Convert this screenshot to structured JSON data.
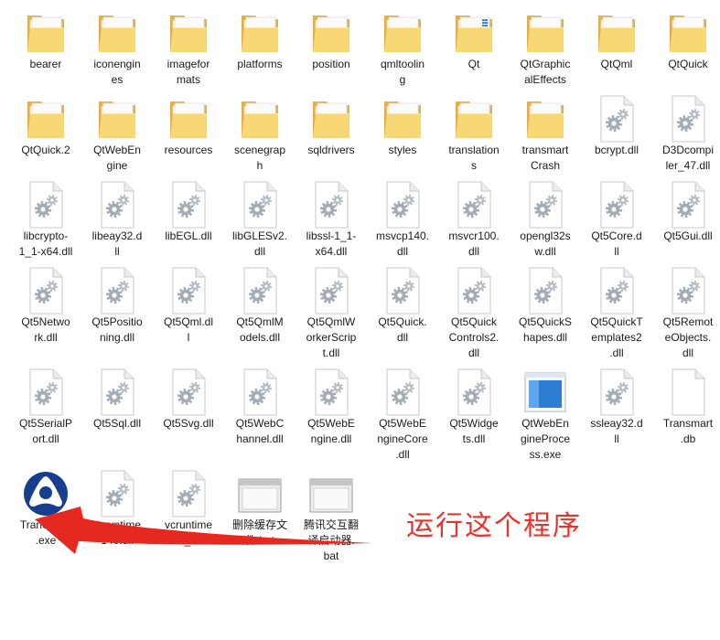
{
  "items": [
    {
      "icon": "folder",
      "lines": [
        "bearer"
      ]
    },
    {
      "icon": "folder",
      "lines": [
        "iconengin",
        "es"
      ]
    },
    {
      "icon": "folder",
      "lines": [
        "imagefor",
        "mats"
      ]
    },
    {
      "icon": "folder",
      "lines": [
        "platforms"
      ]
    },
    {
      "icon": "folder",
      "lines": [
        "position"
      ]
    },
    {
      "icon": "folder",
      "lines": [
        "qmltoolin",
        "g"
      ]
    },
    {
      "icon": "folder-doc",
      "lines": [
        "Qt"
      ]
    },
    {
      "icon": "folder",
      "lines": [
        "QtGraphic",
        "alEffects"
      ]
    },
    {
      "icon": "folder",
      "lines": [
        "QtQml"
      ]
    },
    {
      "icon": "folder",
      "lines": [
        "QtQuick"
      ]
    },
    {
      "icon": "folder",
      "lines": [
        "QtQuick.2"
      ]
    },
    {
      "icon": "folder",
      "lines": [
        "QtWebEn",
        "gine"
      ]
    },
    {
      "icon": "folder",
      "lines": [
        "resources"
      ]
    },
    {
      "icon": "folder",
      "lines": [
        "scenegrap",
        "h"
      ]
    },
    {
      "icon": "folder",
      "lines": [
        "sqldrivers"
      ]
    },
    {
      "icon": "folder",
      "lines": [
        "styles"
      ]
    },
    {
      "icon": "folder",
      "lines": [
        "translation",
        "s"
      ]
    },
    {
      "icon": "folder",
      "lines": [
        "transmart",
        "Crash"
      ]
    },
    {
      "icon": "dll-gears",
      "lines": [
        "bcrypt.dll"
      ]
    },
    {
      "icon": "dll-gears",
      "lines": [
        "D3Dcompi",
        "ler_47.dll"
      ]
    },
    {
      "icon": "dll-gears",
      "lines": [
        "libcrypto-",
        "1_1-x64.dll"
      ]
    },
    {
      "icon": "dll-gears",
      "lines": [
        "libeay32.d",
        "ll"
      ]
    },
    {
      "icon": "dll-gears",
      "lines": [
        "libEGL.dll"
      ]
    },
    {
      "icon": "dll-gears",
      "lines": [
        "libGLESv2.",
        "dll"
      ]
    },
    {
      "icon": "dll-gears",
      "lines": [
        "libssl-1_1-",
        "x64.dll"
      ]
    },
    {
      "icon": "dll-gears",
      "lines": [
        "msvcp140.",
        "dll"
      ]
    },
    {
      "icon": "dll-gears",
      "lines": [
        "msvcr100.",
        "dll"
      ]
    },
    {
      "icon": "dll-gears",
      "lines": [
        "opengl32s",
        "w.dll"
      ]
    },
    {
      "icon": "dll-gears",
      "lines": [
        "Qt5Core.d",
        "ll"
      ]
    },
    {
      "icon": "dll-gears",
      "lines": [
        "Qt5Gui.dll"
      ]
    },
    {
      "icon": "dll-gears",
      "lines": [
        "Qt5Netwo",
        "rk.dll"
      ]
    },
    {
      "icon": "dll-gears",
      "lines": [
        "Qt5Positio",
        "ning.dll"
      ]
    },
    {
      "icon": "dll-gears",
      "lines": [
        "Qt5Qml.dl",
        "l"
      ]
    },
    {
      "icon": "dll-gears",
      "lines": [
        "Qt5QmlM",
        "odels.dll"
      ]
    },
    {
      "icon": "dll-gears",
      "lines": [
        "Qt5QmlW",
        "orkerScrip",
        "t.dll"
      ]
    },
    {
      "icon": "dll-gears",
      "lines": [
        "Qt5Quick.",
        "dll"
      ]
    },
    {
      "icon": "dll-gears",
      "lines": [
        "Qt5Quick",
        "Controls2.",
        "dll"
      ]
    },
    {
      "icon": "dll-gears",
      "lines": [
        "Qt5QuickS",
        "hapes.dll"
      ]
    },
    {
      "icon": "dll-gears",
      "lines": [
        "Qt5QuickT",
        "emplates2",
        ".dll"
      ]
    },
    {
      "icon": "dll-gears",
      "lines": [
        "Qt5Remot",
        "eObjects.",
        "dll"
      ]
    },
    {
      "icon": "dll-gears",
      "lines": [
        "Qt5SerialP",
        "ort.dll"
      ]
    },
    {
      "icon": "dll-gears",
      "lines": [
        "Qt5Sql.dll"
      ]
    },
    {
      "icon": "dll-gears",
      "lines": [
        "Qt5Svg.dll"
      ]
    },
    {
      "icon": "dll-gears",
      "lines": [
        "Qt5WebC",
        "hannel.dll"
      ]
    },
    {
      "icon": "dll-gears",
      "lines": [
        "Qt5WebE",
        "ngine.dll"
      ]
    },
    {
      "icon": "dll-gears",
      "lines": [
        "Qt5WebE",
        "ngineCore",
        ".dll"
      ]
    },
    {
      "icon": "dll-gears",
      "lines": [
        "Qt5Widge",
        "ts.dll"
      ]
    },
    {
      "icon": "app-window",
      "lines": [
        "QtWebEn",
        "gineProce",
        "ss.exe"
      ]
    },
    {
      "icon": "dll-gears",
      "lines": [
        "ssleay32.d",
        "ll"
      ]
    },
    {
      "icon": "blank-file",
      "lines": [
        "Transmart",
        ".db"
      ]
    },
    {
      "icon": "transmart-logo",
      "lines": [
        "TranSmart",
        ".exe"
      ]
    },
    {
      "icon": "dll-gears",
      "lines": [
        "vcruntime",
        "140.dll"
      ]
    },
    {
      "icon": "dll-gears",
      "lines": [
        "vcruntime",
        "140_1.dll"
      ]
    },
    {
      "icon": "batch-window",
      "lines": [
        "删除缓存文",
        "件.bat"
      ]
    },
    {
      "icon": "batch-window",
      "lines": [
        "腾讯交互翻",
        "译启动器.",
        "bat"
      ]
    }
  ],
  "annotation": {
    "text": "运行这个程序",
    "color": "#e8322c",
    "arrow_color": "#e62920"
  }
}
